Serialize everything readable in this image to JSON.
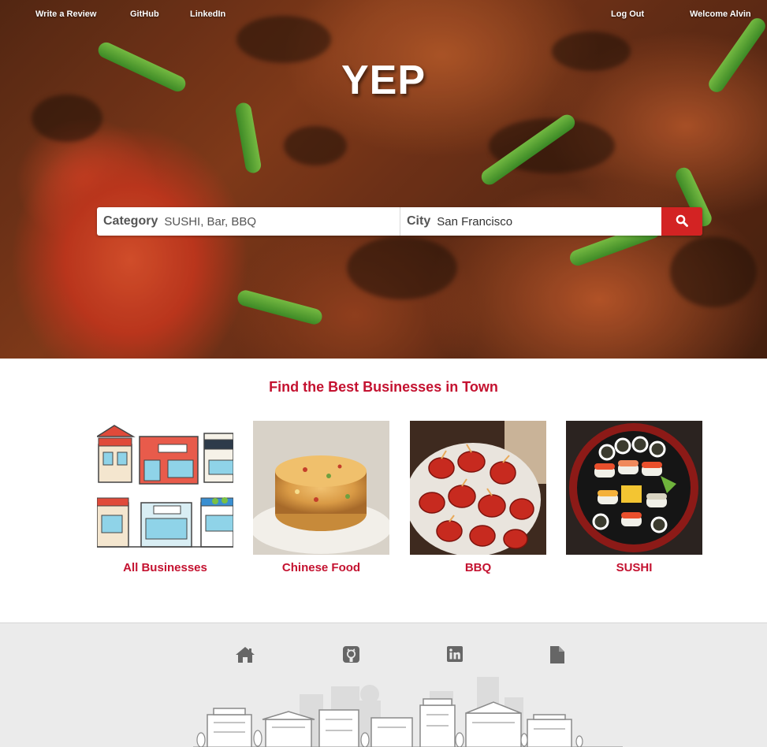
{
  "nav": {
    "write_review": "Write a Review",
    "github": "GitHub",
    "linkedin": "LinkedIn",
    "logout": "Log Out",
    "welcome": "Welcome Alvin"
  },
  "hero": {
    "logo": "YEP"
  },
  "search": {
    "category_label": "Category",
    "category_placeholder": "SUSHI, Bar, BBQ",
    "category_value": "",
    "city_label": "City",
    "city_value": "San Francisco",
    "button_icon": "search-icon"
  },
  "main": {
    "title": "Find the Best Businesses in Town",
    "categories": [
      {
        "label": "All Businesses",
        "image": "storefronts-illustration"
      },
      {
        "label": "Chinese Food",
        "image": "fried-rice-photo"
      },
      {
        "label": "BBQ",
        "image": "bbq-bites-photo"
      },
      {
        "label": "SUSHI",
        "image": "sushi-platter-photo"
      }
    ]
  },
  "footer": {
    "icons": [
      "home-icon",
      "github-icon",
      "linkedin-icon",
      "file-icon"
    ],
    "decoration": "city-skyline-illustration"
  },
  "colors": {
    "accent_red": "#c41230",
    "button_red": "#d32323",
    "footer_bg": "#ebebeb",
    "footer_icon": "#666666"
  }
}
